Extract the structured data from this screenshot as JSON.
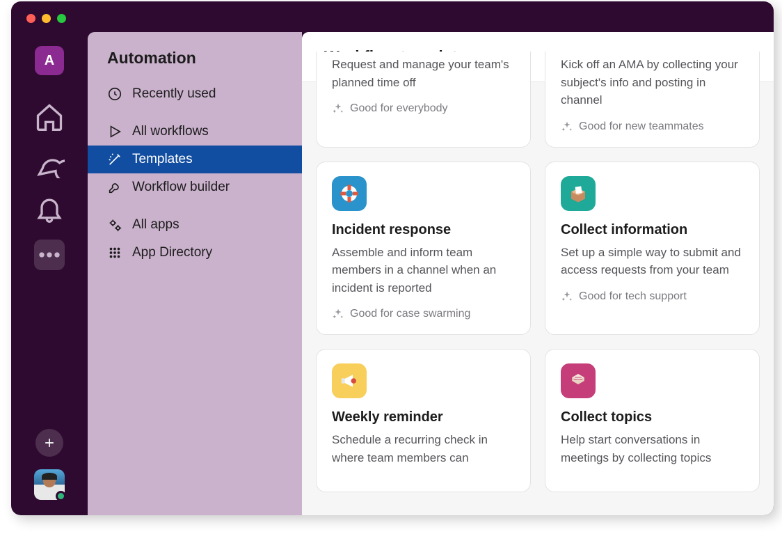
{
  "workspace_letter": "A",
  "panel": {
    "title": "Automation",
    "recently_used": "Recently used",
    "all_workflows": "All workflows",
    "templates": "Templates",
    "workflow_builder": "Workflow builder",
    "all_apps": "All apps",
    "app_directory": "App Directory"
  },
  "content": {
    "title": "Workflow templates"
  },
  "cards": [
    {
      "desc": "Request and manage your team's planned time off",
      "tag": "Good for everybody"
    },
    {
      "desc": "Kick off an AMA by collecting your subject's info and posting in channel",
      "tag": "Good for new teammates"
    },
    {
      "title": "Incident response",
      "desc": "Assemble and inform team members in a channel when an incident is reported",
      "tag": "Good for case swarming"
    },
    {
      "title": "Collect information",
      "desc": "Set up a simple way to submit and access requests from your team",
      "tag": "Good for tech support"
    },
    {
      "title": "Weekly reminder",
      "desc": "Schedule a recurring check in where team members can",
      "tag": ""
    },
    {
      "title": "Collect topics",
      "desc": "Help start conversations in meetings by collecting topics",
      "tag": ""
    }
  ]
}
